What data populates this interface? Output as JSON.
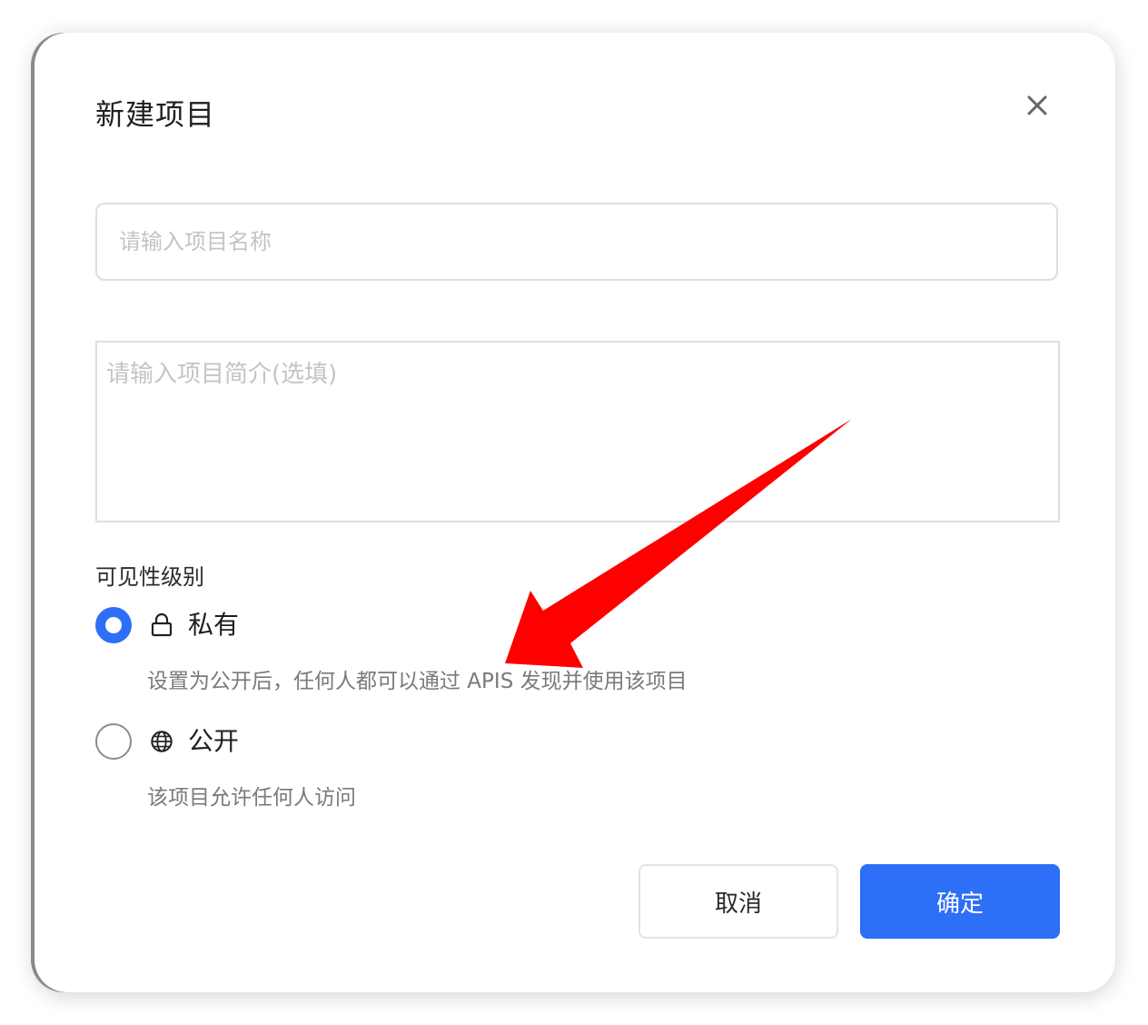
{
  "dialog": {
    "title": "新建项目",
    "close_icon": "close-icon"
  },
  "form": {
    "name_placeholder": "请输入项目名称",
    "name_value": "",
    "desc_placeholder": "请输入项目简介(选填)",
    "desc_value": ""
  },
  "visibility": {
    "label": "可见性级别",
    "options": [
      {
        "label": "私有",
        "icon": "lock-icon",
        "description": "设置为公开后，任何人都可以通过 APIS 发现并使用该项目",
        "selected": true
      },
      {
        "label": "公开",
        "icon": "globe-icon",
        "description": "该项目允许任何人访问",
        "selected": false
      }
    ]
  },
  "actions": {
    "cancel_label": "取消",
    "confirm_label": "确定"
  },
  "colors": {
    "accent": "#2d6ff6",
    "annotation_arrow": "#ff0000"
  }
}
